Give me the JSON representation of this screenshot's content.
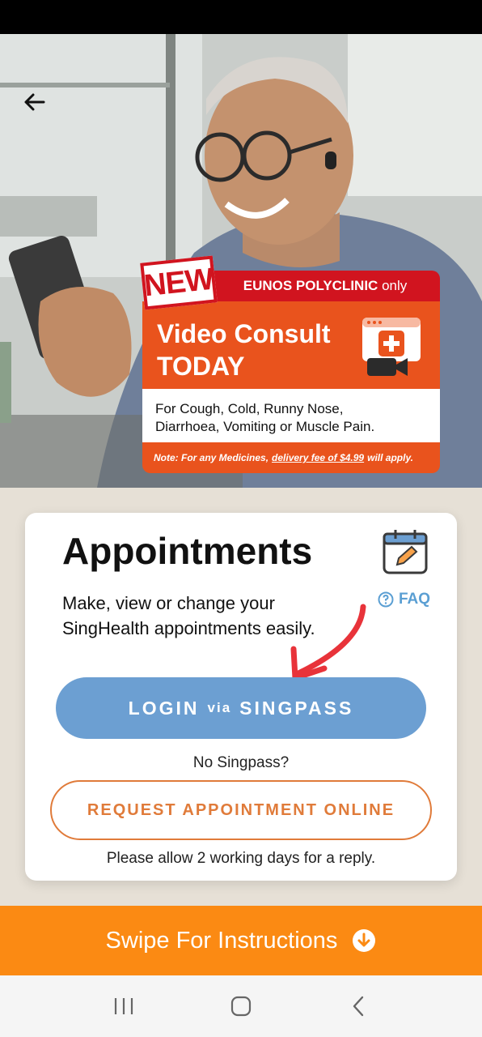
{
  "promo": {
    "new_badge": "NEW",
    "header_bold": "EUNOS POLYCLINIC",
    "header_rest": "only",
    "title_line1": "Video Consult",
    "title_line2": "TODAY",
    "subtitle_line1": "For Cough, Cold, Runny Nose,",
    "subtitle_line2": "Diarrhoea, Vomiting or Muscle Pain.",
    "note_prefix": "Note: For any Medicines,",
    "note_link": "delivery fee of $4.99",
    "note_suffix": "will apply."
  },
  "card": {
    "title": "Appointments",
    "description": "Make, view or change your SingHealth appointments easily.",
    "faq_label": "FAQ",
    "login_prefix": "LOGIN",
    "login_via": "via",
    "login_suffix": "SINGPASS",
    "no_singpass": "No Singpass?",
    "request_label": "REQUEST APPOINTMENT ONLINE",
    "reply_note": "Please allow 2 working days for a reply."
  },
  "swipe": {
    "label": "Swipe For Instructions"
  },
  "icons": {
    "back": "arrow-left-icon",
    "calendar": "calendar-edit-icon",
    "faq": "question-circle-icon",
    "swipe": "arrow-down-circle-icon",
    "video": "video-consult-icon"
  },
  "colors": {
    "brand_orange": "#e9531d",
    "brand_red": "#d1141f",
    "login_blue": "#6c9fd2",
    "request_orange": "#e07b3a",
    "swipe_orange": "#fb8a13",
    "annotation_red": "#e8333a"
  }
}
